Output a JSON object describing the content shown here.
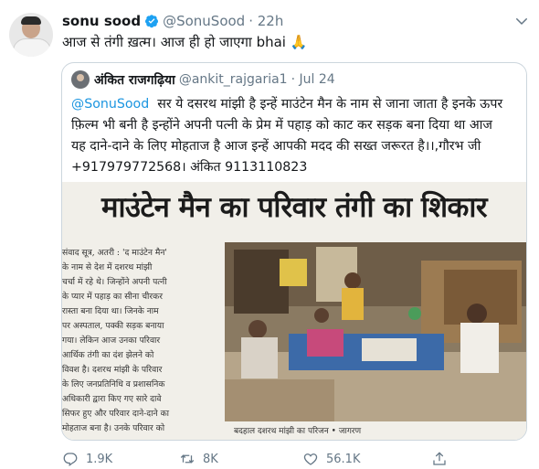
{
  "tweet": {
    "name": "sonu sood",
    "handle": "@SonuSood",
    "time": "· 22h",
    "text": "आज से तंगी ख़त्म। आज ही हो जाएगा bhai 🙏"
  },
  "quote": {
    "name": "अंकित राजगढ़िया",
    "handle": "@ankit_rajgaria1",
    "time": "· Jul 24",
    "mention": "@SonuSood",
    "lines": [
      "सर ये दसरथ मांझी है इन्हें माउंटेन मैन के नाम से जाना जाता है इनके ऊपर",
      "फ़िल्म भी बनी है इन्होंने अपनी पत्नी के प्रेम में पहाड़ को काट कर सड़क बना दिया था आज",
      "यह दाने-दाने के लिए मोहताज है आज इन्हें आपकी मदद की सख्त जरूरत है।।,गौरभ जी",
      "+917979772568। अंकित 9113110823"
    ]
  },
  "clipping": {
    "headline": "माउंटेन मैन का परिवार तंगी का शिकार",
    "article_lines": [
      "संवाद सूत्र, अतरी : 'द माउंटेन मैन'",
      "के नाम से देश में दशरथ मांझी",
      "चर्चा में रहे थे। जिन्होंने अपनी पत्नी",
      "के प्यार में पहाड़ का सीना चीरकर",
      "रास्ता बना दिया था। जिनके नाम",
      "पर अस्पताल, पक्की सड़क बनाया",
      "गया। लेकिन आज उनका परिवार",
      "आर्थिक तंगी का दंश झेलने को",
      "विवश है। दशरथ मांझी के परिवार",
      "के लिए जनप्रतिनिधि व प्रशासनिक",
      "अधिकारी द्वारा किए गए सारे दावे",
      "सिफर हुए और परिवार दाने-दाने का",
      "मोहताज बना है। उनके परिवार को"
    ],
    "caption": "बदहाल दशरथ मांझी का परिजन • जागरण"
  },
  "actions": {
    "replies": "1.9K",
    "retweets": "8K",
    "likes": "56.1K"
  },
  "icons": {
    "verified": "verified-badge-icon",
    "more": "chevron-down-icon",
    "reply": "reply-icon",
    "retweet": "retweet-icon",
    "like": "heart-icon",
    "share": "share-icon"
  },
  "colors": {
    "accent": "#1da1f2",
    "muted": "#657786",
    "border": "#ccd6dd"
  }
}
